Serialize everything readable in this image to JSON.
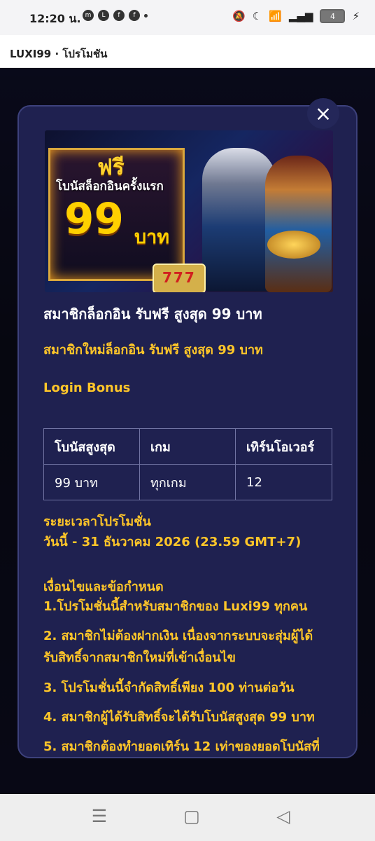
{
  "status": {
    "time": "12:20 น.",
    "battery": "4",
    "icons": [
      "messenger-icon",
      "line-icon",
      "facebook-icon",
      "facebook-icon",
      "dot-icon"
    ]
  },
  "app": {
    "title": "LUXI99 · โปรโมชัน"
  },
  "modal": {
    "banner": {
      "free": "ฟรี",
      "subtitle": "โบนัสล็อกอินครั้งแรก",
      "amount": "99",
      "unit": "บาท",
      "slot": "777"
    },
    "title": "สมาชิกล็อกอิน รับฟรี สูงสุด 99 บาท",
    "subtitle": "สมาชิกใหม่ล็อกอิน รับฟรี สูงสุด 99 บาท",
    "section": "Login Bonus",
    "table": {
      "headers": [
        "โบนัสสูงสุด",
        "เกม",
        "เทิร์นโอเวอร์"
      ],
      "row": [
        "99 บาท",
        "ทุกเกม",
        "12"
      ]
    },
    "period_heading": "ระยะเวลาโปรโมชั่น",
    "period_value": "วันนี้ - 31 ธันวาคม 2026 (23.59 GMT+7)",
    "conditions_heading": "เงื่อนไขและข้อกำหนด",
    "conditions": [
      "1.โปรโมชั่นนี้สำหรับสมาชิกของ Luxi99 ทุกคน",
      "2. สมาชิกไม่ต้องฝากเงิน เนื่องจากระบบจะสุ่มผู้ได้",
      "รับสิทธิ์จากสมาชิกใหม่ที่เข้าเงื่อนไข",
      "3. โปรโมชั่นนี้จำกัดสิทธิ์เพียง 100 ท่านต่อวัน",
      "4. สมาชิกผู้ได้รับสิทธิ์จะได้รับโบนัสสูงสุด 99 บาท",
      "5. สมาชิกต้องทำยอดเทิร์น 12 เท่าของยอดโบนัสที่"
    ]
  },
  "close_symbol": "×",
  "nav_symbols": {
    "recent": "☰",
    "home": "▢",
    "back": "◁"
  }
}
